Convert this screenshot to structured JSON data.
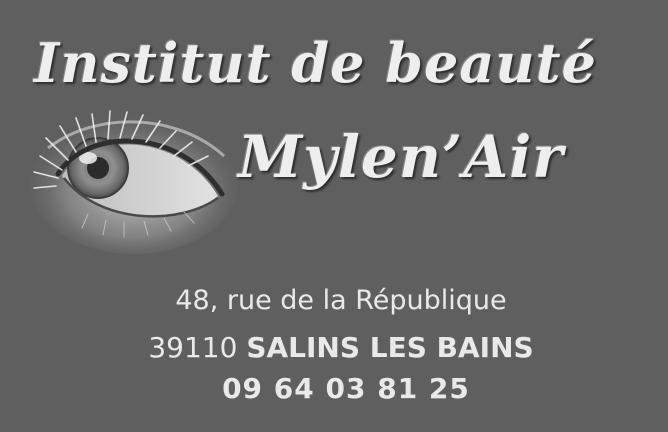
{
  "card": {
    "title_line1": "Institut de beauté",
    "title_line2": "Mylen’Air",
    "image": "eye-illustration",
    "address": {
      "street": "48, rue de la République",
      "postal_code": "39110",
      "city": "SALINS LES BAINS"
    },
    "phone": "09 64 03 81 25"
  },
  "colors": {
    "background": "#5f5f60",
    "text": "#e9e9e9"
  }
}
